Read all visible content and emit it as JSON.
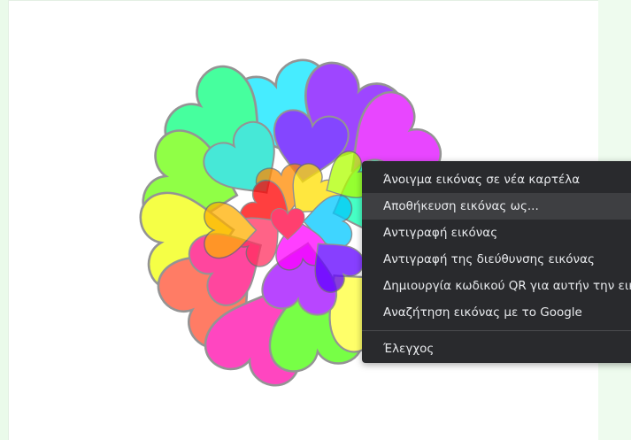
{
  "context_menu": {
    "items": [
      {
        "label": "Άνοιγμα εικόνας σε νέα καρτέλα",
        "state": "normal"
      },
      {
        "label": "Αποθήκευση εικόνας ως...",
        "state": "hovered"
      },
      {
        "label": "Αντιγραφή εικόνας",
        "state": "normal"
      },
      {
        "label": "Αντιγραφή της διεύθυνσης εικόνας",
        "state": "normal"
      },
      {
        "label": "Δημιουργία κωδικού QR για αυτήν την εικόνα",
        "state": "normal"
      },
      {
        "label": "Αναζήτηση εικόνας με το Google",
        "state": "normal"
      }
    ],
    "inspect_label": "Έλεγχος"
  },
  "colors": {
    "menu_background": "#292a2d",
    "menu_hover": "#3e3f42",
    "menu_text": "#e8eaed",
    "page_background": "#eefbee",
    "canvas_background": "#ffffff"
  },
  "artwork": {
    "description_icon": "overlapping-hearts-image"
  }
}
